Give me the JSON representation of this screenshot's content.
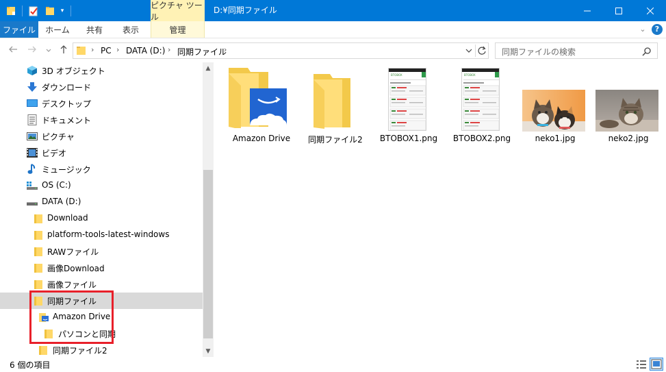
{
  "title_bar": {
    "context_tab_header": "ピクチャ ツール",
    "path_title": "D:¥同期ファイル"
  },
  "ribbon": {
    "tabs": [
      "ファイル",
      "ホーム",
      "共有",
      "表示"
    ],
    "context_tab": "管理"
  },
  "address": {
    "breadcrumbs": [
      "PC",
      "DATA (D:)",
      "同期ファイル"
    ],
    "search_placeholder": "同期ファイルの検索"
  },
  "nav_pane": {
    "items": [
      {
        "label": "3D オブジェクト",
        "icon": "3d-objects-icon"
      },
      {
        "label": "ダウンロード",
        "icon": "downloads-icon"
      },
      {
        "label": "デスクトップ",
        "icon": "desktop-icon"
      },
      {
        "label": "ドキュメント",
        "icon": "documents-icon"
      },
      {
        "label": "ピクチャ",
        "icon": "pictures-icon"
      },
      {
        "label": "ビデオ",
        "icon": "videos-icon"
      },
      {
        "label": "ミュージック",
        "icon": "music-icon"
      },
      {
        "label": "OS (C:)",
        "icon": "drive-c-icon"
      },
      {
        "label": "DATA (D:)",
        "icon": "drive-d-icon"
      },
      {
        "label": "Download",
        "icon": "folder-icon"
      },
      {
        "label": "platform-tools-latest-windows",
        "icon": "folder-icon"
      },
      {
        "label": "RAWファイル",
        "icon": "folder-icon"
      },
      {
        "label": "画像Download",
        "icon": "folder-icon"
      },
      {
        "label": "画像ファイル",
        "icon": "folder-icon"
      },
      {
        "label": "同期ファイル",
        "icon": "folder-icon"
      },
      {
        "label": "Amazon Drive",
        "icon": "amazon-drive-folder-icon"
      },
      {
        "label": "パソコンと同期",
        "icon": "folder-icon"
      },
      {
        "label": "同期ファイル2",
        "icon": "folder-icon"
      }
    ]
  },
  "files": [
    {
      "name": "Amazon Drive",
      "icon": "amazon-drive-folder-icon"
    },
    {
      "name": "同期ファイル2",
      "icon": "folder-icon"
    },
    {
      "name": "BTOBOX1.png",
      "icon": "png-thumbnail"
    },
    {
      "name": "BTOBOX2.png",
      "icon": "png-thumbnail"
    },
    {
      "name": "neko1.jpg",
      "icon": "jpg-thumbnail"
    },
    {
      "name": "neko2.jpg",
      "icon": "jpg-thumbnail"
    }
  ],
  "thumb_text": {
    "brand": "BTOBOX"
  },
  "status": {
    "item_count": "6 個の項目"
  },
  "colors": {
    "titlebar": "#0078d7",
    "file_tab": "#1979ca",
    "context_tab": "#fff2b5",
    "folder": "#ffd868",
    "selection": "#d9d9d9",
    "highlight_box": "#e8202a"
  }
}
